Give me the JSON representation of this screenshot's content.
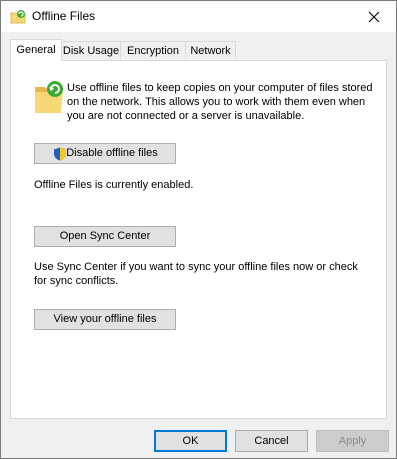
{
  "window": {
    "title": "Offline Files"
  },
  "tabs": [
    {
      "label": "General",
      "active": true
    },
    {
      "label": "Disk Usage",
      "active": false
    },
    {
      "label": "Encryption",
      "active": false
    },
    {
      "label": "Network",
      "active": false
    }
  ],
  "general": {
    "description": "Use offline files to keep copies on your computer of files stored on the network.  This allows you to work with them even when you are not connected or a server is unavailable.",
    "disable_button": "Disable offline files",
    "status_text": "Offline Files is currently enabled.",
    "sync_center_button": "Open Sync Center",
    "sync_center_text": "Use Sync Center if you want to sync your offline files now or check for sync conflicts.",
    "view_files_button": "View your offline files"
  },
  "footer": {
    "ok": "OK",
    "cancel": "Cancel",
    "apply": "Apply"
  },
  "colors": {
    "accent": "#0078d7",
    "folder": "#f8d775",
    "sync_green": "#3aa935"
  }
}
